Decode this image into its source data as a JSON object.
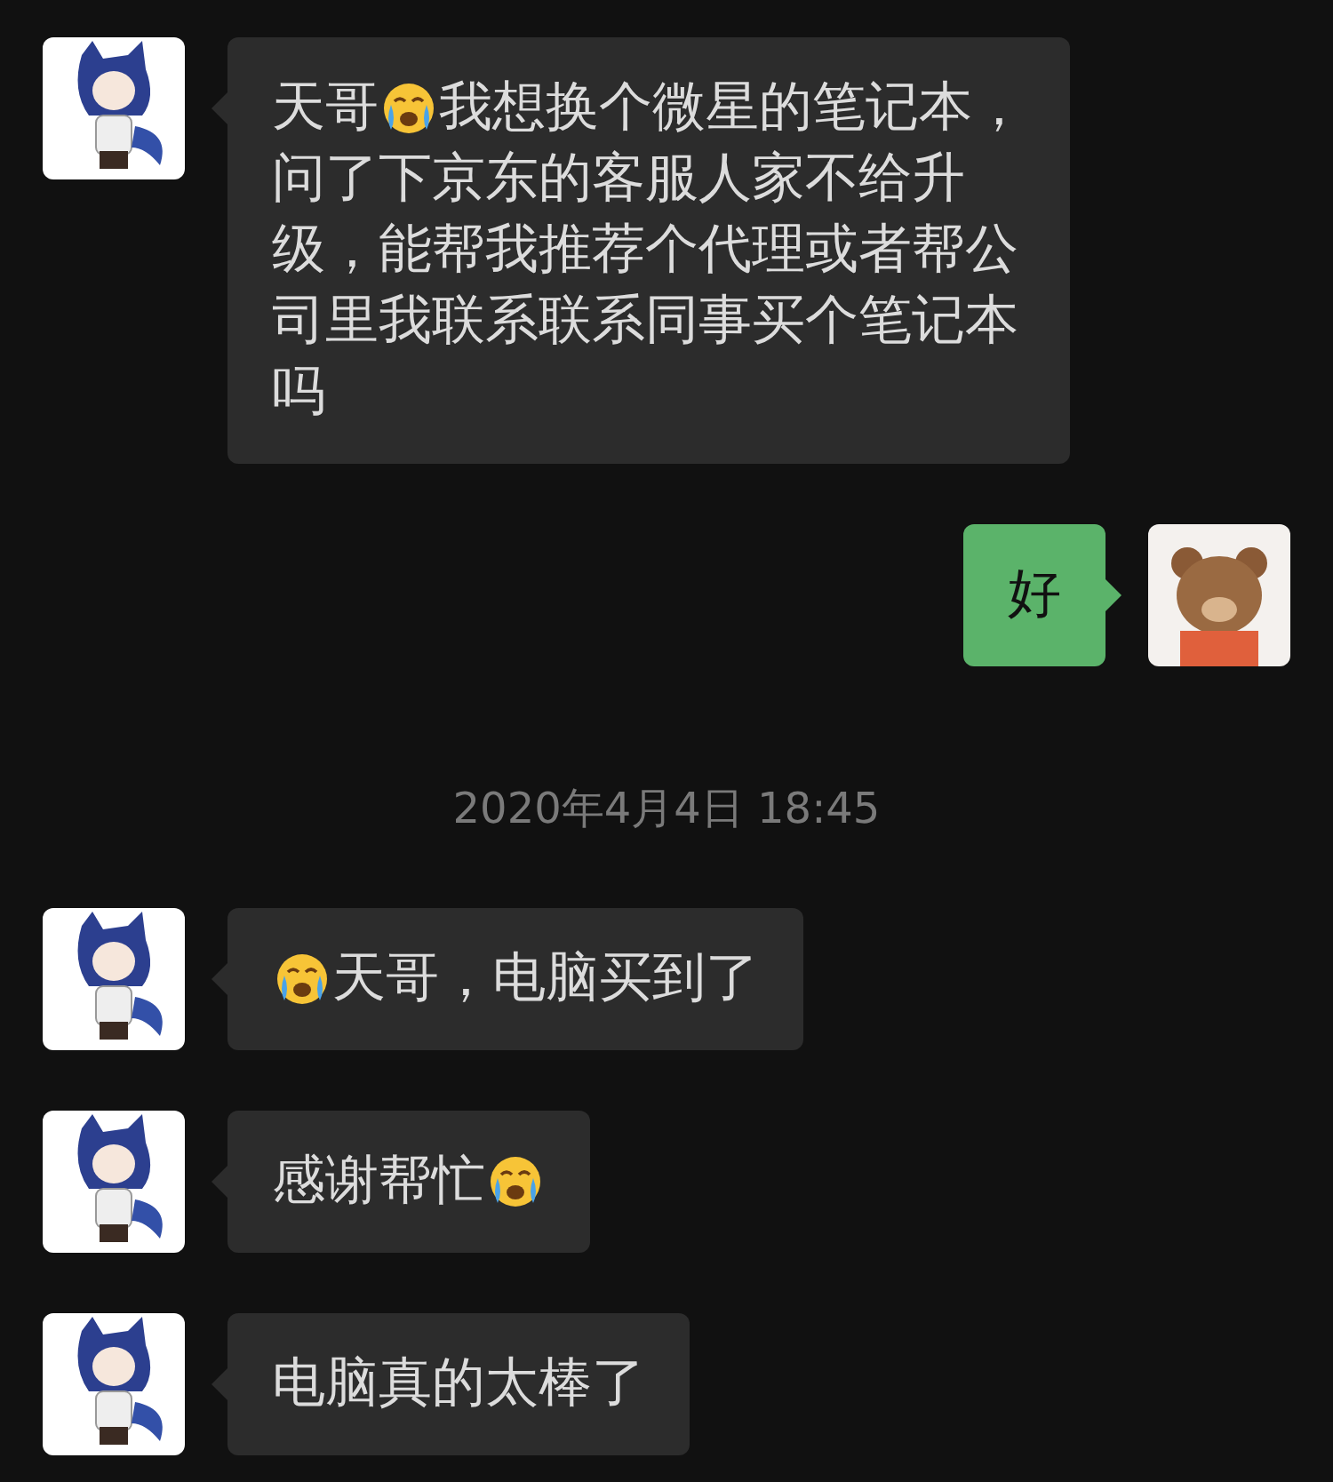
{
  "messages": [
    {
      "kind": "incoming",
      "lines": [
        [
          {
            "kind": "text",
            "text": "天哥"
          },
          {
            "kind": "emoji"
          },
          {
            "kind": "text",
            "text": "我想换个微星的笔记本，"
          }
        ],
        [
          {
            "kind": "text",
            "text": "问了下京东的客服人家不给升"
          }
        ],
        [
          {
            "kind": "text",
            "text": "级，能帮我推荐个代理或者帮公"
          }
        ],
        [
          {
            "kind": "text",
            "text": "司里我联系联系同事买个笔记本"
          }
        ],
        [
          {
            "kind": "text",
            "text": "吗"
          }
        ]
      ]
    },
    {
      "kind": "outgoing",
      "lines": [
        [
          {
            "kind": "text",
            "text": "好"
          }
        ]
      ]
    },
    {
      "kind": "time",
      "text": "2020年4月4日 18:45"
    },
    {
      "kind": "incoming",
      "lines": [
        [
          {
            "kind": "emoji"
          },
          {
            "kind": "text",
            "text": "天哥，电脑买到了"
          }
        ]
      ]
    },
    {
      "kind": "incoming",
      "lines": [
        [
          {
            "kind": "text",
            "text": "感谢帮忙"
          },
          {
            "kind": "emoji"
          }
        ]
      ]
    },
    {
      "kind": "incoming",
      "lines": [
        [
          {
            "kind": "text",
            "text": "电脑真的太棒了"
          }
        ]
      ]
    }
  ]
}
